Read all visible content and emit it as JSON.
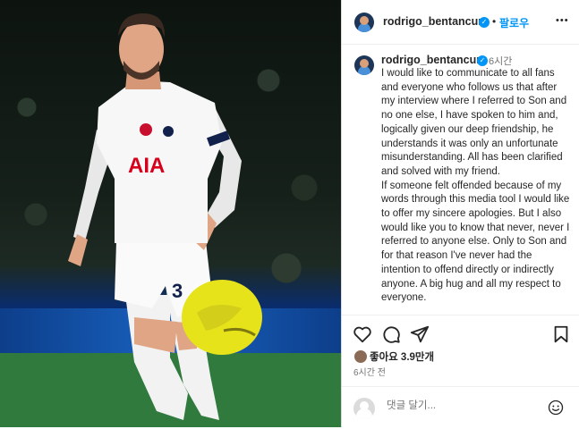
{
  "post": {
    "username": "rodrigo_bentancur",
    "follow_label": "팔로우",
    "dot": "•",
    "more": "•••",
    "time_ago_short": "6시간",
    "caption": "I would like to communicate to all fans and everyone who follows us that after my interview where I referred to Son and no one else, I have spoken to him and, logically given our deep friendship, he understands it was only an unfortunate misunderstanding. All has been clarified and solved with my friend.\nIf someone felt offended because of my words through this media tool I would like to offer my sincere apologies. But I also would like you to know that never, never I referred to anyone else. Only to Son and for that reason I've never had the intention to offend directly or indirectly anyone. A big hug and all my respect to everyone.\n\nPor este medio quiero comunicarles a todos los fans y a todos aquellos",
    "likes_text": "좋아요 3.9만개",
    "time_ago_long": "6시간 전",
    "comment_placeholder": "댓글 달기..."
  },
  "photo": {
    "shirt_sponsor": "AIA",
    "shirt_number": "3"
  },
  "icons": [
    "verified-badge-icon",
    "more-options-icon",
    "heart-icon",
    "comment-icon",
    "share-icon",
    "bookmark-icon",
    "emoji-icon"
  ],
  "colors": {
    "accent": "#0095f6",
    "text": "#262626",
    "muted": "#737373"
  }
}
